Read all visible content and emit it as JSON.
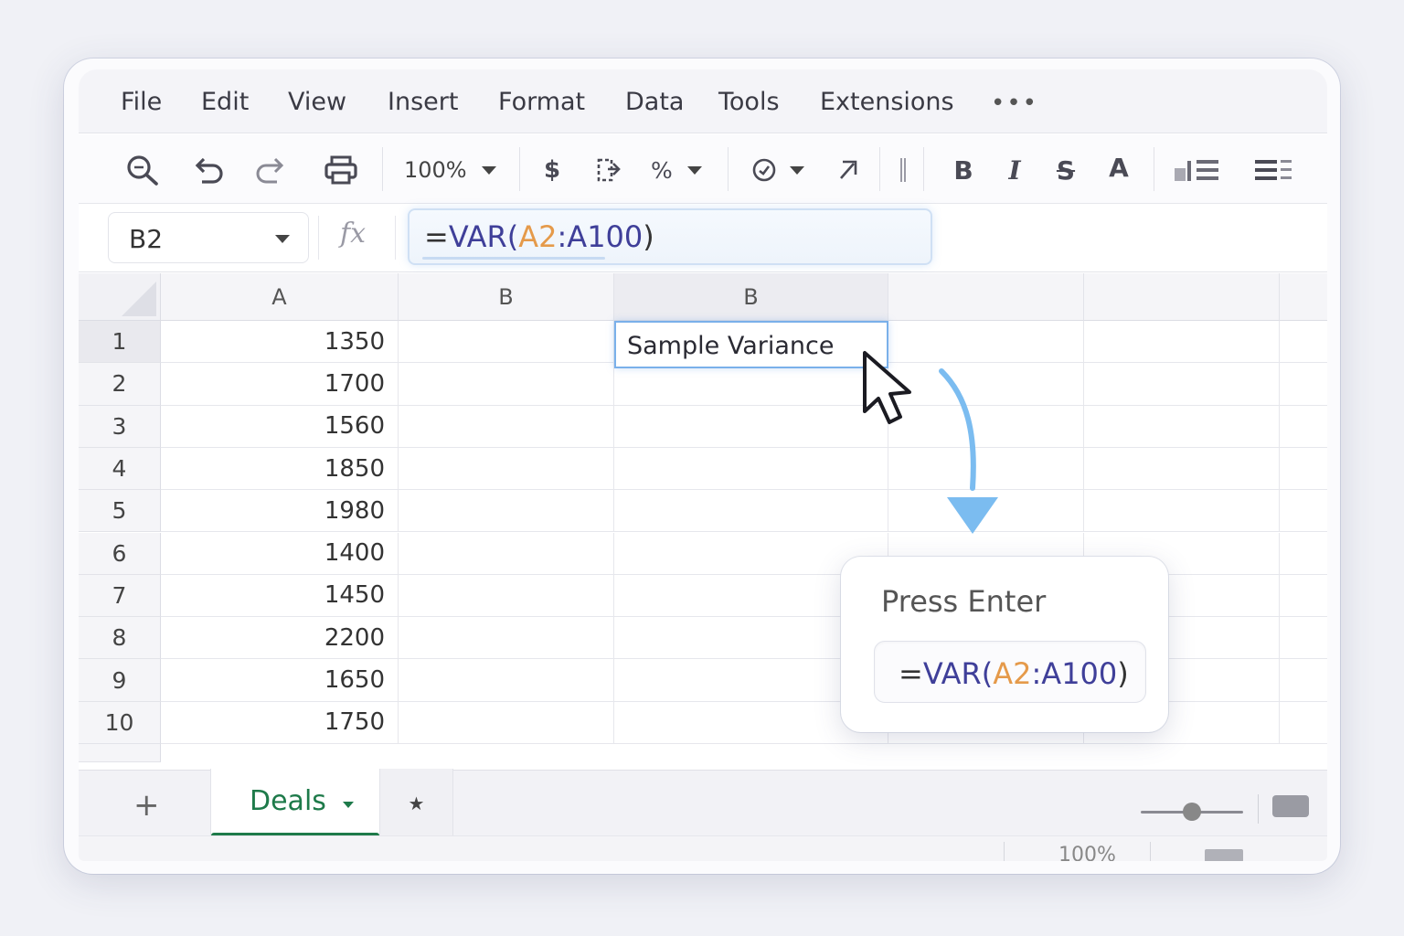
{
  "menu": [
    "File",
    "Edit",
    "View",
    "Insert",
    "Format",
    "Data",
    "Tools",
    "Extensions"
  ],
  "menu_more": "•••",
  "toolbar": {
    "zoom": "100%",
    "currency": "$",
    "percent": "%",
    "bold": "B",
    "italic": "I",
    "strike": "S",
    "text_color": "A",
    "icons": [
      "search-icon",
      "undo-icon",
      "redo-icon",
      "print-icon",
      "currency-icon",
      "format-icon",
      "percent-icon",
      "clock-icon",
      "link-arrow-icon",
      "divider-icon",
      "bold-icon",
      "italic-icon",
      "strikethrough-icon",
      "text-color-icon",
      "chart-icon",
      "align-icon"
    ]
  },
  "formula_bar": {
    "name_box": "B2",
    "fx": "fx",
    "formula": {
      "eq": "=",
      "fn": "VAR(",
      "ref1": "A2",
      "colon": ":",
      "ref2": "A100",
      "close": ")"
    }
  },
  "columns": [
    "A",
    "B",
    "B"
  ],
  "rows": [
    {
      "num": "1",
      "a": "1350"
    },
    {
      "num": "2",
      "a": "1700"
    },
    {
      "num": "3",
      "a": "1560"
    },
    {
      "num": "4",
      "a": "1850"
    },
    {
      "num": "5",
      "a": "1980"
    },
    {
      "num": "6",
      "a": "1400"
    },
    {
      "num": "7",
      "a": "1450"
    },
    {
      "num": "8",
      "a": "2200"
    },
    {
      "num": "9",
      "a": "1650"
    },
    {
      "num": "10",
      "a": "1750"
    }
  ],
  "selected_cell_text": "Sample Variance",
  "hint_card": {
    "title": "Press Enter",
    "formula": {
      "eq": "=",
      "fn": "VAR(",
      "ref1": "A2",
      "colon": ":",
      "ref2": "A100",
      "close": ")"
    }
  },
  "sheet_tabs": {
    "add": "+",
    "active": "Deals",
    "extra": "★"
  },
  "status": {
    "zoom": "100%"
  },
  "colors": {
    "accent_green": "#1e7a4a",
    "ref_orange": "#e59a4a",
    "fn_blue": "#3f3f99",
    "selection_blue": "#7ab0ea"
  }
}
